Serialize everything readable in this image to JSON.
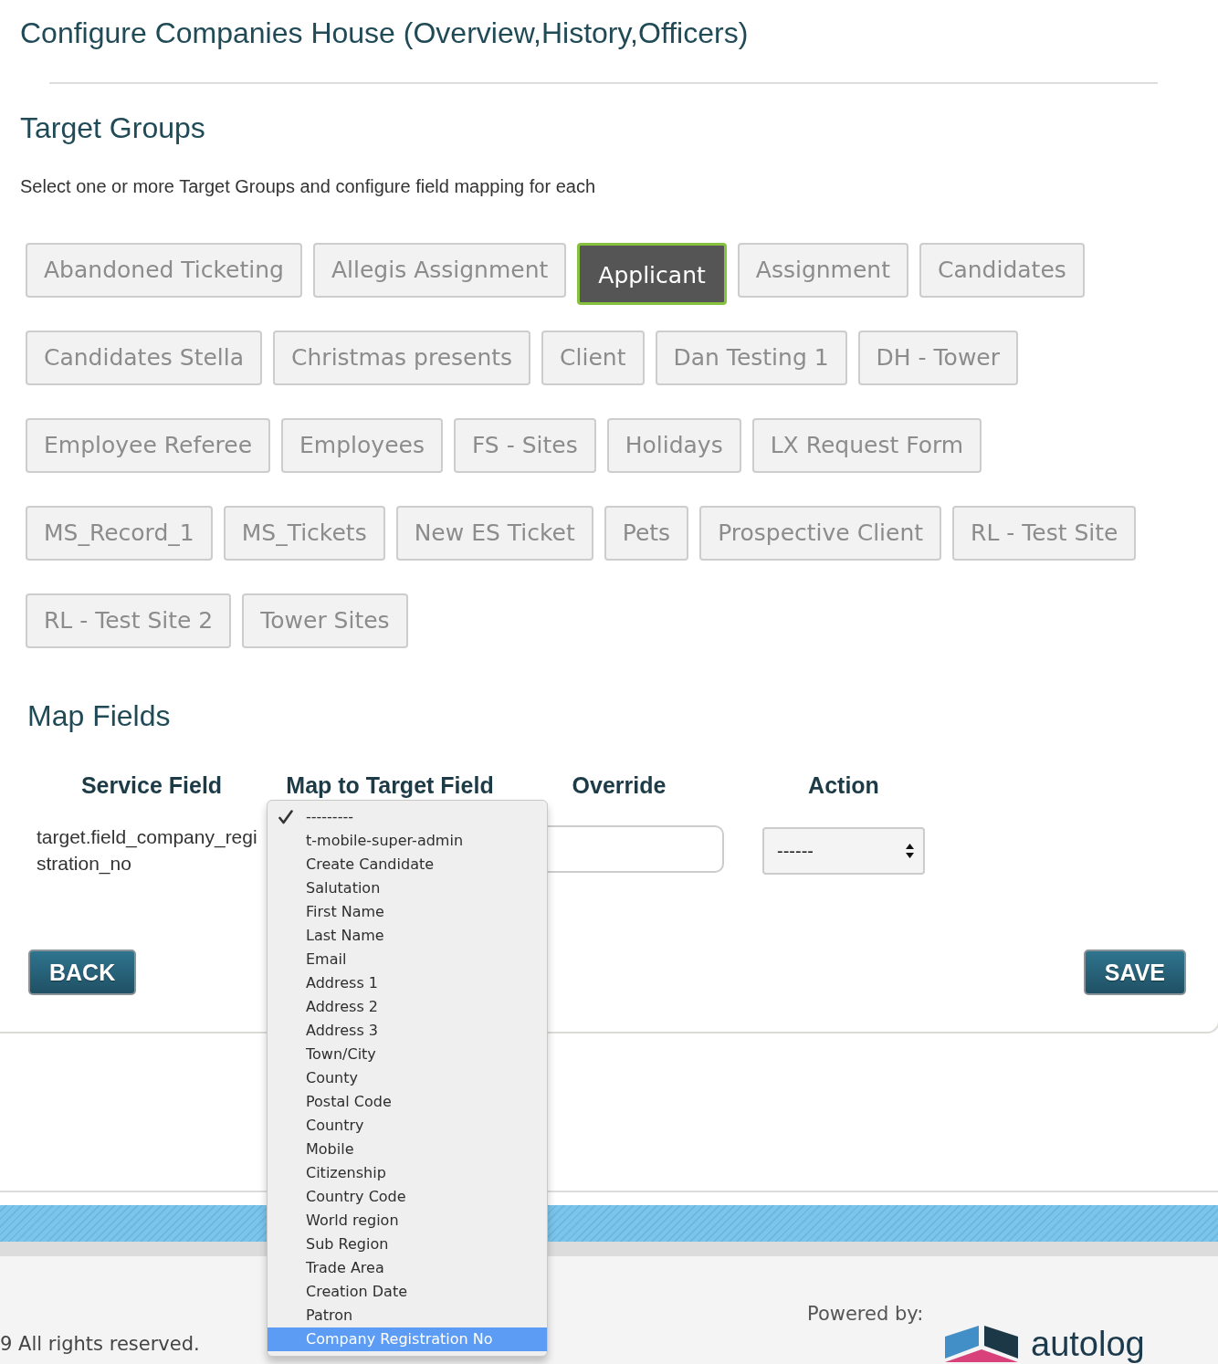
{
  "page": {
    "title": "Configure Companies House (Overview,History,Officers)"
  },
  "target_groups": {
    "heading": "Target Groups",
    "description": "Select one or more Target Groups and configure field mapping for each",
    "groups": [
      {
        "label": "Abandoned Ticketing",
        "selected": false
      },
      {
        "label": "Allegis Assignment",
        "selected": false
      },
      {
        "label": "Applicant",
        "selected": true
      },
      {
        "label": "Assignment",
        "selected": false
      },
      {
        "label": "Candidates",
        "selected": false
      },
      {
        "label": "Candidates Stella",
        "selected": false
      },
      {
        "label": "Christmas presents",
        "selected": false
      },
      {
        "label": "Client",
        "selected": false
      },
      {
        "label": "Dan Testing 1",
        "selected": false
      },
      {
        "label": "DH - Tower",
        "selected": false
      },
      {
        "label": "Employee Referee",
        "selected": false
      },
      {
        "label": "Employees",
        "selected": false
      },
      {
        "label": "FS - Sites",
        "selected": false
      },
      {
        "label": "Holidays",
        "selected": false
      },
      {
        "label": "LX Request Form",
        "selected": false
      },
      {
        "label": "MS_Record_1",
        "selected": false
      },
      {
        "label": "MS_Tickets",
        "selected": false
      },
      {
        "label": "New ES Ticket",
        "selected": false
      },
      {
        "label": "Pets",
        "selected": false
      },
      {
        "label": "Prospective Client",
        "selected": false
      },
      {
        "label": "RL - Test Site",
        "selected": false
      },
      {
        "label": "RL - Test Site 2",
        "selected": false
      },
      {
        "label": "Tower Sites",
        "selected": false
      }
    ]
  },
  "map_fields": {
    "heading": "Map Fields",
    "columns": [
      "Service Field",
      "Map to Target Field",
      "Override",
      "Action"
    ],
    "rows": [
      {
        "service_field": "target.field_company_registration_no",
        "map_to_target": {
          "expanded": true,
          "options": [
            {
              "label": "---------",
              "selected": true,
              "highlighted": false
            },
            {
              "label": "t-mobile-super-admin",
              "selected": false,
              "highlighted": false
            },
            {
              "label": "Create Candidate",
              "selected": false,
              "highlighted": false
            },
            {
              "label": "Salutation",
              "selected": false,
              "highlighted": false
            },
            {
              "label": "First Name",
              "selected": false,
              "highlighted": false
            },
            {
              "label": "Last Name",
              "selected": false,
              "highlighted": false
            },
            {
              "label": "Email",
              "selected": false,
              "highlighted": false
            },
            {
              "label": "Address 1",
              "selected": false,
              "highlighted": false
            },
            {
              "label": "Address 2",
              "selected": false,
              "highlighted": false
            },
            {
              "label": "Address 3",
              "selected": false,
              "highlighted": false
            },
            {
              "label": "Town/City",
              "selected": false,
              "highlighted": false
            },
            {
              "label": "County",
              "selected": false,
              "highlighted": false
            },
            {
              "label": "Postal Code",
              "selected": false,
              "highlighted": false
            },
            {
              "label": "Country",
              "selected": false,
              "highlighted": false
            },
            {
              "label": "Mobile",
              "selected": false,
              "highlighted": false
            },
            {
              "label": "Citizenship",
              "selected": false,
              "highlighted": false
            },
            {
              "label": "Country Code",
              "selected": false,
              "highlighted": false
            },
            {
              "label": "World region",
              "selected": false,
              "highlighted": false
            },
            {
              "label": "Sub Region",
              "selected": false,
              "highlighted": false
            },
            {
              "label": "Trade Area",
              "selected": false,
              "highlighted": false
            },
            {
              "label": "Creation Date",
              "selected": false,
              "highlighted": false
            },
            {
              "label": "Patron",
              "selected": false,
              "highlighted": false
            },
            {
              "label": "Company Registration No",
              "selected": false,
              "highlighted": true
            }
          ]
        },
        "action": {
          "value": "------"
        }
      }
    ]
  },
  "actions": {
    "back": "BACK",
    "save": "SAVE"
  },
  "footer": {
    "copyright": "9 All rights reserved.",
    "powered_by": "Powered by:",
    "logo_text": "autolog"
  }
}
